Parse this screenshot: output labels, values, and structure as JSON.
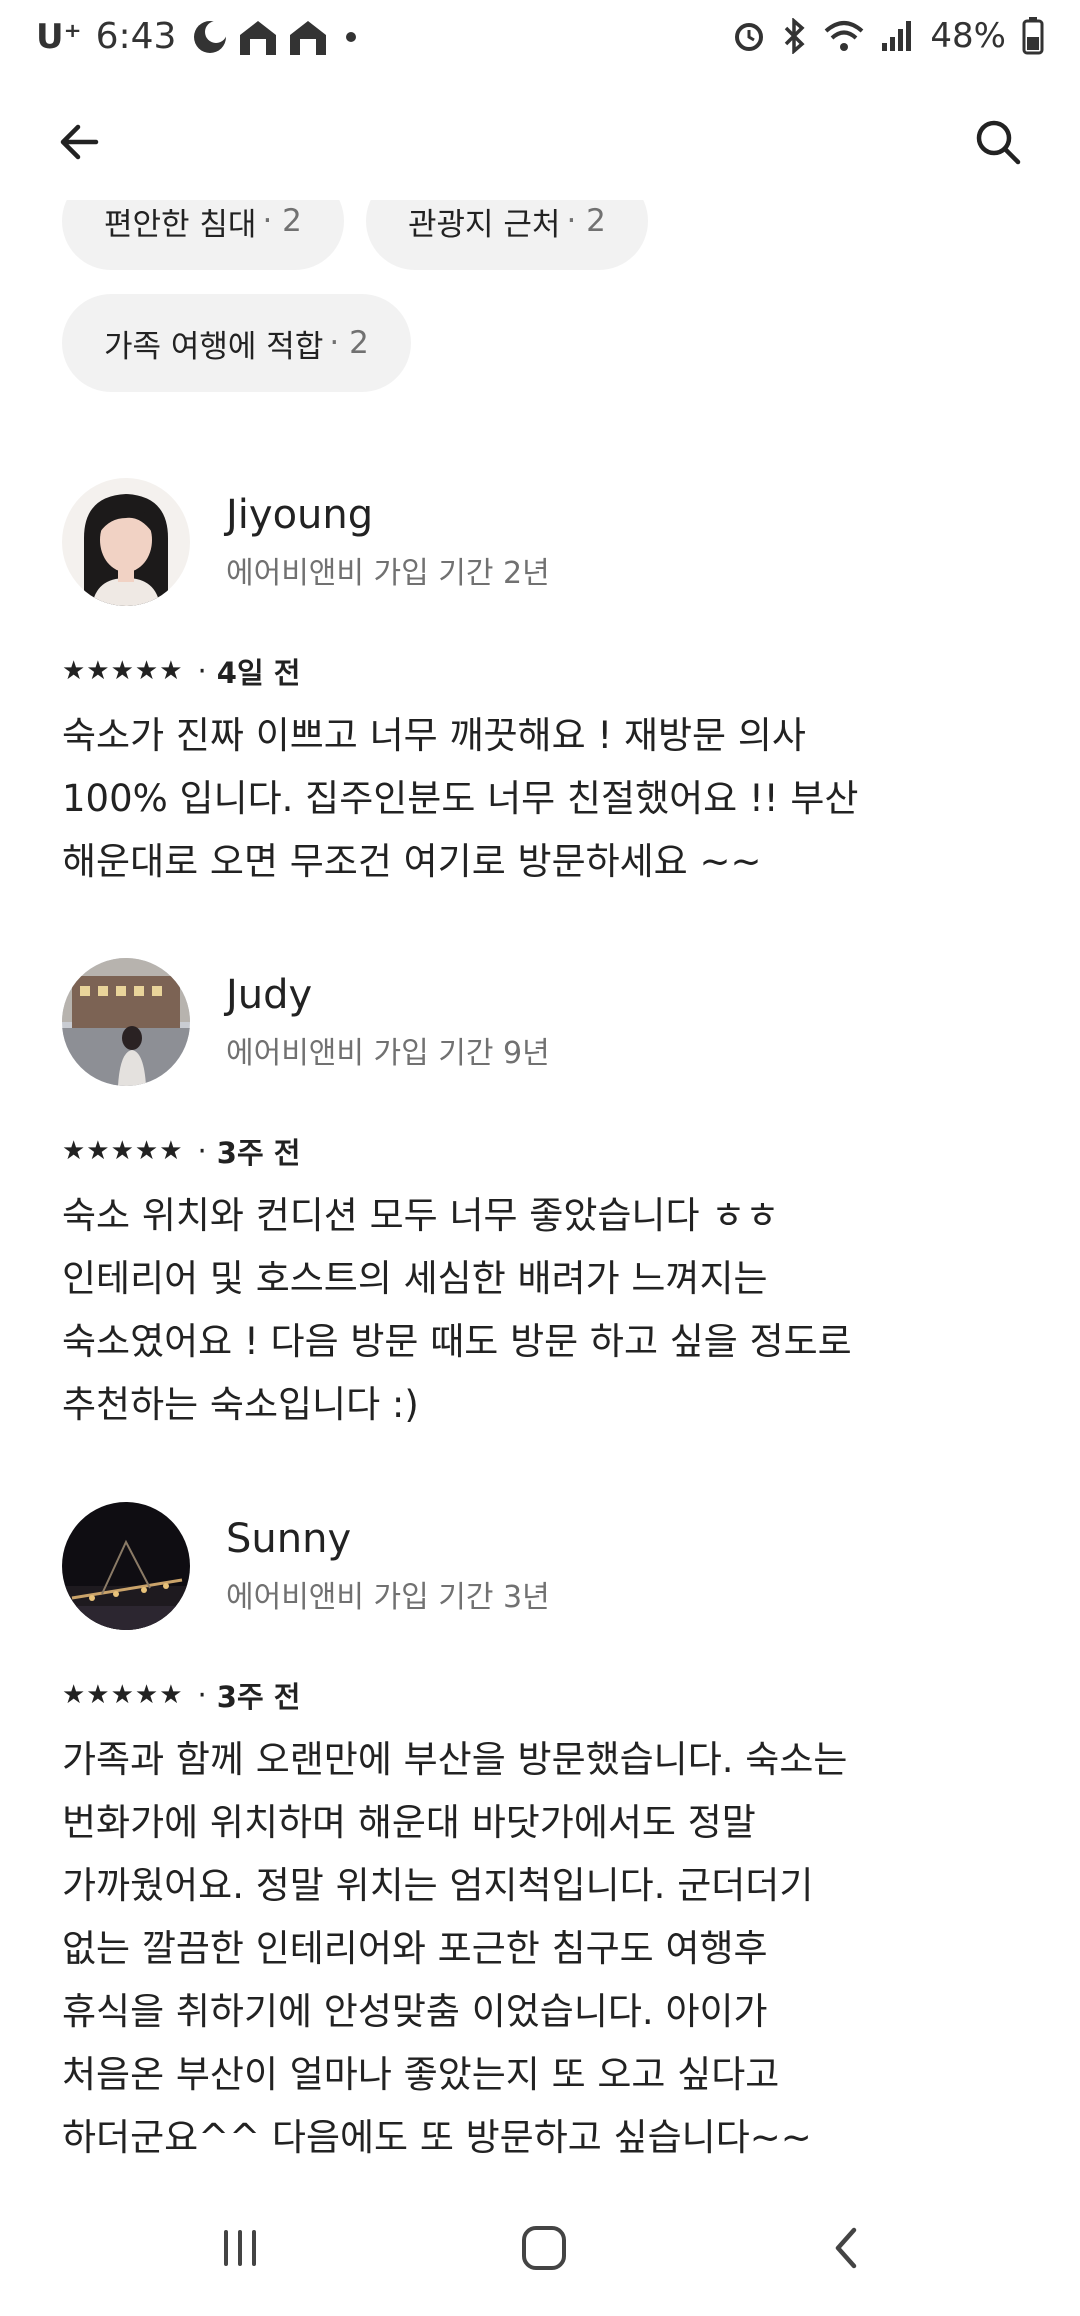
{
  "status_bar": {
    "carrier": "U⁺",
    "time": "6:43",
    "battery": "48%"
  },
  "chips": [
    {
      "label": "편안한 침대",
      "count": "· 2"
    },
    {
      "label": "관광지 근처",
      "count": "· 2"
    },
    {
      "label": "가족 여행에 적합",
      "count": "· 2"
    }
  ],
  "reviews": [
    {
      "name": "Jiyoung",
      "member_since": "에어비앤비 가입 기간 2년",
      "stars": "★★★★★",
      "rating": 5,
      "sep": "·",
      "date": "4일 전",
      "text": "숙소가 진짜 이쁘고 너무 깨끗해요 ! 재방문 의사\n100% 입니다. 집주인분도 너무 친절했어요 !! 부산\n해운대로 오면 무조건 여기로 방문하세요 ~~"
    },
    {
      "name": "Judy",
      "member_since": "에어비앤비 가입 기간 9년",
      "stars": "★★★★★",
      "rating": 5,
      "sep": "·",
      "date": "3주 전",
      "text": "숙소 위치와 컨디션 모두 너무 좋았습니다 ㅎㅎ\n인테리어 및 호스트의 세심한 배려가 느껴지는\n숙소였어요 ! 다음 방문 때도 방문 하고 싶을 정도로\n추천하는 숙소입니다 :)"
    },
    {
      "name": "Sunny",
      "member_since": "에어비앤비 가입 기간 3년",
      "stars": "★★★★★",
      "rating": 5,
      "sep": "·",
      "date": "3주 전",
      "text": "가족과 함께 오랜만에 부산을 방문했습니다. 숙소는\n번화가에 위치하며 해운대 바닷가에서도 정말\n가까웠어요. 정말 위치는 엄지척입니다. 군더더기\n없는 깔끔한 인테리어와 포근한 침구도 여행후\n휴식을 취하기에 안성맞춤 이었습니다. 아이가\n처음온 부산이 얼마나 좋았는지 또 오고 싶다고\n하더군요^^ 다음에도 또 방문하고 싶습니다~~"
    }
  ],
  "icons": {
    "back": "arrow-left-icon",
    "search": "search-icon",
    "nav_recent": "recent-apps-icon",
    "nav_home": "home-icon",
    "nav_back": "nav-back-icon"
  }
}
